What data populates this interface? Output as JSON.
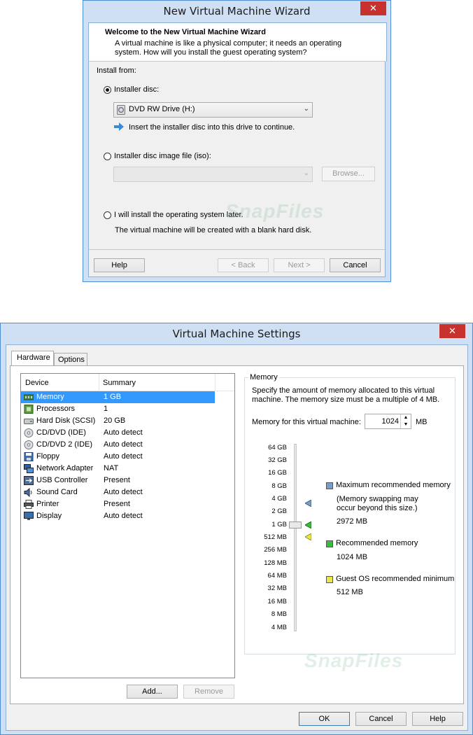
{
  "wizard": {
    "title": "New Virtual Machine Wizard",
    "close_glyph": "✕",
    "header_title": "Welcome to the New Virtual Machine Wizard",
    "header_desc_line1": "A virtual machine is like a physical computer; it needs an operating",
    "header_desc_line2": "system. How will you install the guest operating system?",
    "install_from_label": "Install from:",
    "option_disc_label": "Installer disc:",
    "drive_selected": "DVD RW Drive (H:)",
    "disc_hint": "Insert the installer disc into this drive to continue.",
    "option_iso_label": "Installer disc image file (iso):",
    "iso_value": "",
    "browse_label": "Browse...",
    "option_later_label": "I will install the operating system later.",
    "later_hint": "The virtual machine will be created with a blank hard disk.",
    "help_label": "Help",
    "back_label": "< Back",
    "next_label": "Next >",
    "cancel_label": "Cancel",
    "selected_option": "installer-disc"
  },
  "settings": {
    "title": "Virtual Machine Settings",
    "close_glyph": "✕",
    "tabs": [
      {
        "label": "Hardware",
        "active": true
      },
      {
        "label": "Options",
        "active": false
      }
    ],
    "columns": {
      "device": "Device",
      "summary": "Summary"
    },
    "devices": [
      {
        "name": "Memory",
        "summary": "1 GB",
        "icon": "memory-icon",
        "selected": true
      },
      {
        "name": "Processors",
        "summary": "1",
        "icon": "processor-icon"
      },
      {
        "name": "Hard Disk (SCSI)",
        "summary": "20 GB",
        "icon": "hard-disk-icon"
      },
      {
        "name": "CD/DVD (IDE)",
        "summary": "Auto detect",
        "icon": "cd-dvd-icon"
      },
      {
        "name": "CD/DVD 2 (IDE)",
        "summary": "Auto detect",
        "icon": "cd-dvd-icon"
      },
      {
        "name": "Floppy",
        "summary": "Auto detect",
        "icon": "floppy-icon"
      },
      {
        "name": "Network Adapter",
        "summary": "NAT",
        "icon": "network-adapter-icon"
      },
      {
        "name": "USB Controller",
        "summary": "Present",
        "icon": "usb-icon"
      },
      {
        "name": "Sound Card",
        "summary": "Auto detect",
        "icon": "sound-card-icon"
      },
      {
        "name": "Printer",
        "summary": "Present",
        "icon": "printer-icon"
      },
      {
        "name": "Display",
        "summary": "Auto detect",
        "icon": "display-icon"
      }
    ],
    "add_label": "Add...",
    "remove_label": "Remove",
    "memory_group_label": "Memory",
    "memory_desc_line1": "Specify the amount of memory allocated to this virtual",
    "memory_desc_line2": "machine. The memory size must be a multiple of 4 MB.",
    "memory_field_label": "Memory for this virtual machine:",
    "memory_value": "1024",
    "memory_unit": "MB",
    "scale_ticks": [
      "64 GB",
      "32 GB",
      "16 GB",
      "8 GB",
      "4 GB",
      "2 GB",
      "1 GB",
      "512 MB",
      "256 MB",
      "128 MB",
      "64 MB",
      "32 MB",
      "16 MB",
      "8 MB",
      "4 MB"
    ],
    "slider_value": "1 GB",
    "legend": {
      "max_label": "Maximum recommended memory",
      "max_note_line1": "(Memory swapping may",
      "max_note_line2": "occur beyond this size.)",
      "max_value": "2972 MB",
      "rec_label": "Recommended memory",
      "rec_value": "1024 MB",
      "min_label": "Guest OS recommended minimum",
      "min_value": "512 MB"
    },
    "colors": {
      "max": "#7a9cc6",
      "rec": "#3fb83f",
      "min": "#e8e84a",
      "selection": "#3399ff"
    },
    "ok_label": "OK",
    "cancel_label": "Cancel",
    "help_label": "Help"
  },
  "watermark_text": "SnapFiles"
}
